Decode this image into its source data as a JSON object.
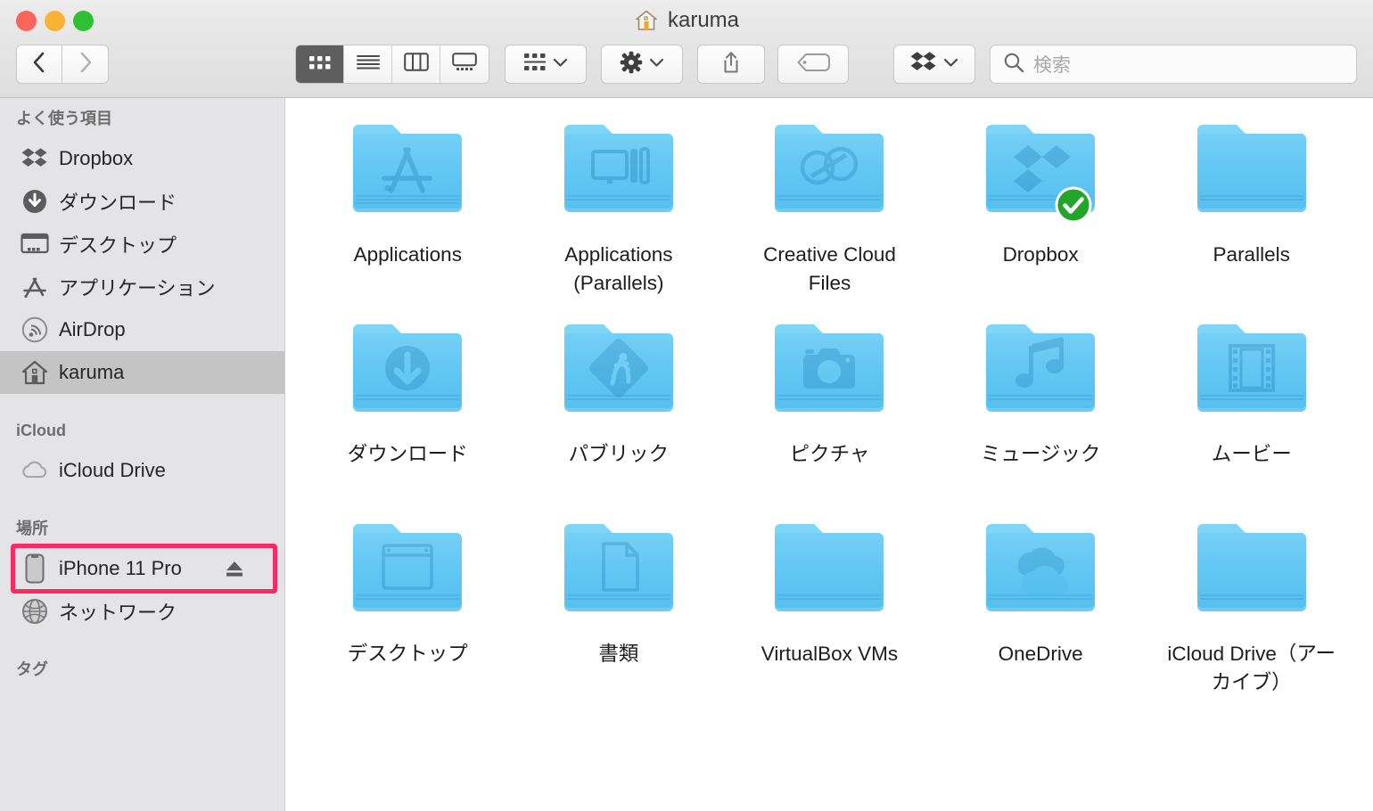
{
  "window": {
    "title": "karuma",
    "title_icon": "home-icon",
    "traffic_lights": [
      {
        "name": "close",
        "color": "#f9655c"
      },
      {
        "name": "minimize",
        "color": "#f9b232"
      },
      {
        "name": "zoom",
        "color": "#2cc032"
      }
    ]
  },
  "toolbar": {
    "back_icon": "chevron-left-icon",
    "forward_icon": "chevron-right-icon",
    "view_modes": [
      {
        "name": "icon-view",
        "icon": "grid-icon",
        "active": true
      },
      {
        "name": "list-view",
        "icon": "list-icon",
        "active": false
      },
      {
        "name": "column-view",
        "icon": "columns-icon",
        "active": false
      },
      {
        "name": "gallery-view",
        "icon": "gallery-icon",
        "active": false
      }
    ],
    "arrange_icon": "arrange-grid-icon",
    "action_icon": "gear-icon",
    "share_icon": "share-icon",
    "tag_icon": "tag-icon",
    "dropbox_icon": "dropbox-icon",
    "chevron_icon": "chevron-down-icon"
  },
  "search": {
    "icon": "search-icon",
    "placeholder": "検索",
    "value": ""
  },
  "sidebar": {
    "sections": [
      {
        "header": "よく使う項目",
        "items": [
          {
            "label": "Dropbox",
            "icon": "dropbox-icon",
            "selected": false
          },
          {
            "label": "ダウンロード",
            "icon": "downloads-icon",
            "selected": false
          },
          {
            "label": "デスクトップ",
            "icon": "desktop-icon",
            "selected": false
          },
          {
            "label": "アプリケーション",
            "icon": "applications-icon",
            "selected": false
          },
          {
            "label": "AirDrop",
            "icon": "airdrop-icon",
            "selected": false
          },
          {
            "label": "karuma",
            "icon": "home-icon",
            "selected": true
          }
        ]
      },
      {
        "header": "iCloud",
        "items": [
          {
            "label": "iCloud Drive",
            "icon": "cloud-icon",
            "selected": false
          }
        ]
      },
      {
        "header": "場所",
        "items": [
          {
            "label": "iPhone 11 Pro",
            "icon": "iphone-icon",
            "selected": false,
            "eject": true,
            "eject_icon": "eject-icon",
            "highlighted": true
          },
          {
            "label": "ネットワーク",
            "icon": "network-icon",
            "selected": false
          }
        ]
      },
      {
        "header": "タグ",
        "items": []
      }
    ],
    "highlight_color": "#fa2a62"
  },
  "content": {
    "items": [
      {
        "label": "Applications",
        "emblem": "appstore-emblem",
        "badge": null
      },
      {
        "label": "Applications\n(Parallels)",
        "emblem": "parallels-emblem",
        "badge": null
      },
      {
        "label": "Creative Cloud\nFiles",
        "emblem": "creativecloud-emblem",
        "badge": null
      },
      {
        "label": "Dropbox",
        "emblem": "dropbox-emblem",
        "badge": "green-check-badge"
      },
      {
        "label": "Parallels",
        "emblem": null,
        "badge": null
      },
      {
        "label": "ダウンロード",
        "emblem": "download-emblem",
        "badge": null
      },
      {
        "label": "パブリック",
        "emblem": "public-emblem",
        "badge": null
      },
      {
        "label": "ピクチャ",
        "emblem": "camera-emblem",
        "badge": null
      },
      {
        "label": "ミュージック",
        "emblem": "music-emblem",
        "badge": null
      },
      {
        "label": "ムービー",
        "emblem": "film-emblem",
        "badge": null
      },
      {
        "label": "デスクトップ",
        "emblem": "window-emblem",
        "badge": null
      },
      {
        "label": "書類",
        "emblem": "document-emblem",
        "badge": null
      },
      {
        "label": "VirtualBox VMs",
        "emblem": null,
        "badge": null
      },
      {
        "label": "OneDrive",
        "emblem": "onedrive-emblem",
        "badge": null
      },
      {
        "label": "iCloud Drive（アーカイブ）",
        "emblem": null,
        "badge": null
      }
    ],
    "folder_color": "#64c9f4",
    "badge_color": "#23a52c"
  }
}
